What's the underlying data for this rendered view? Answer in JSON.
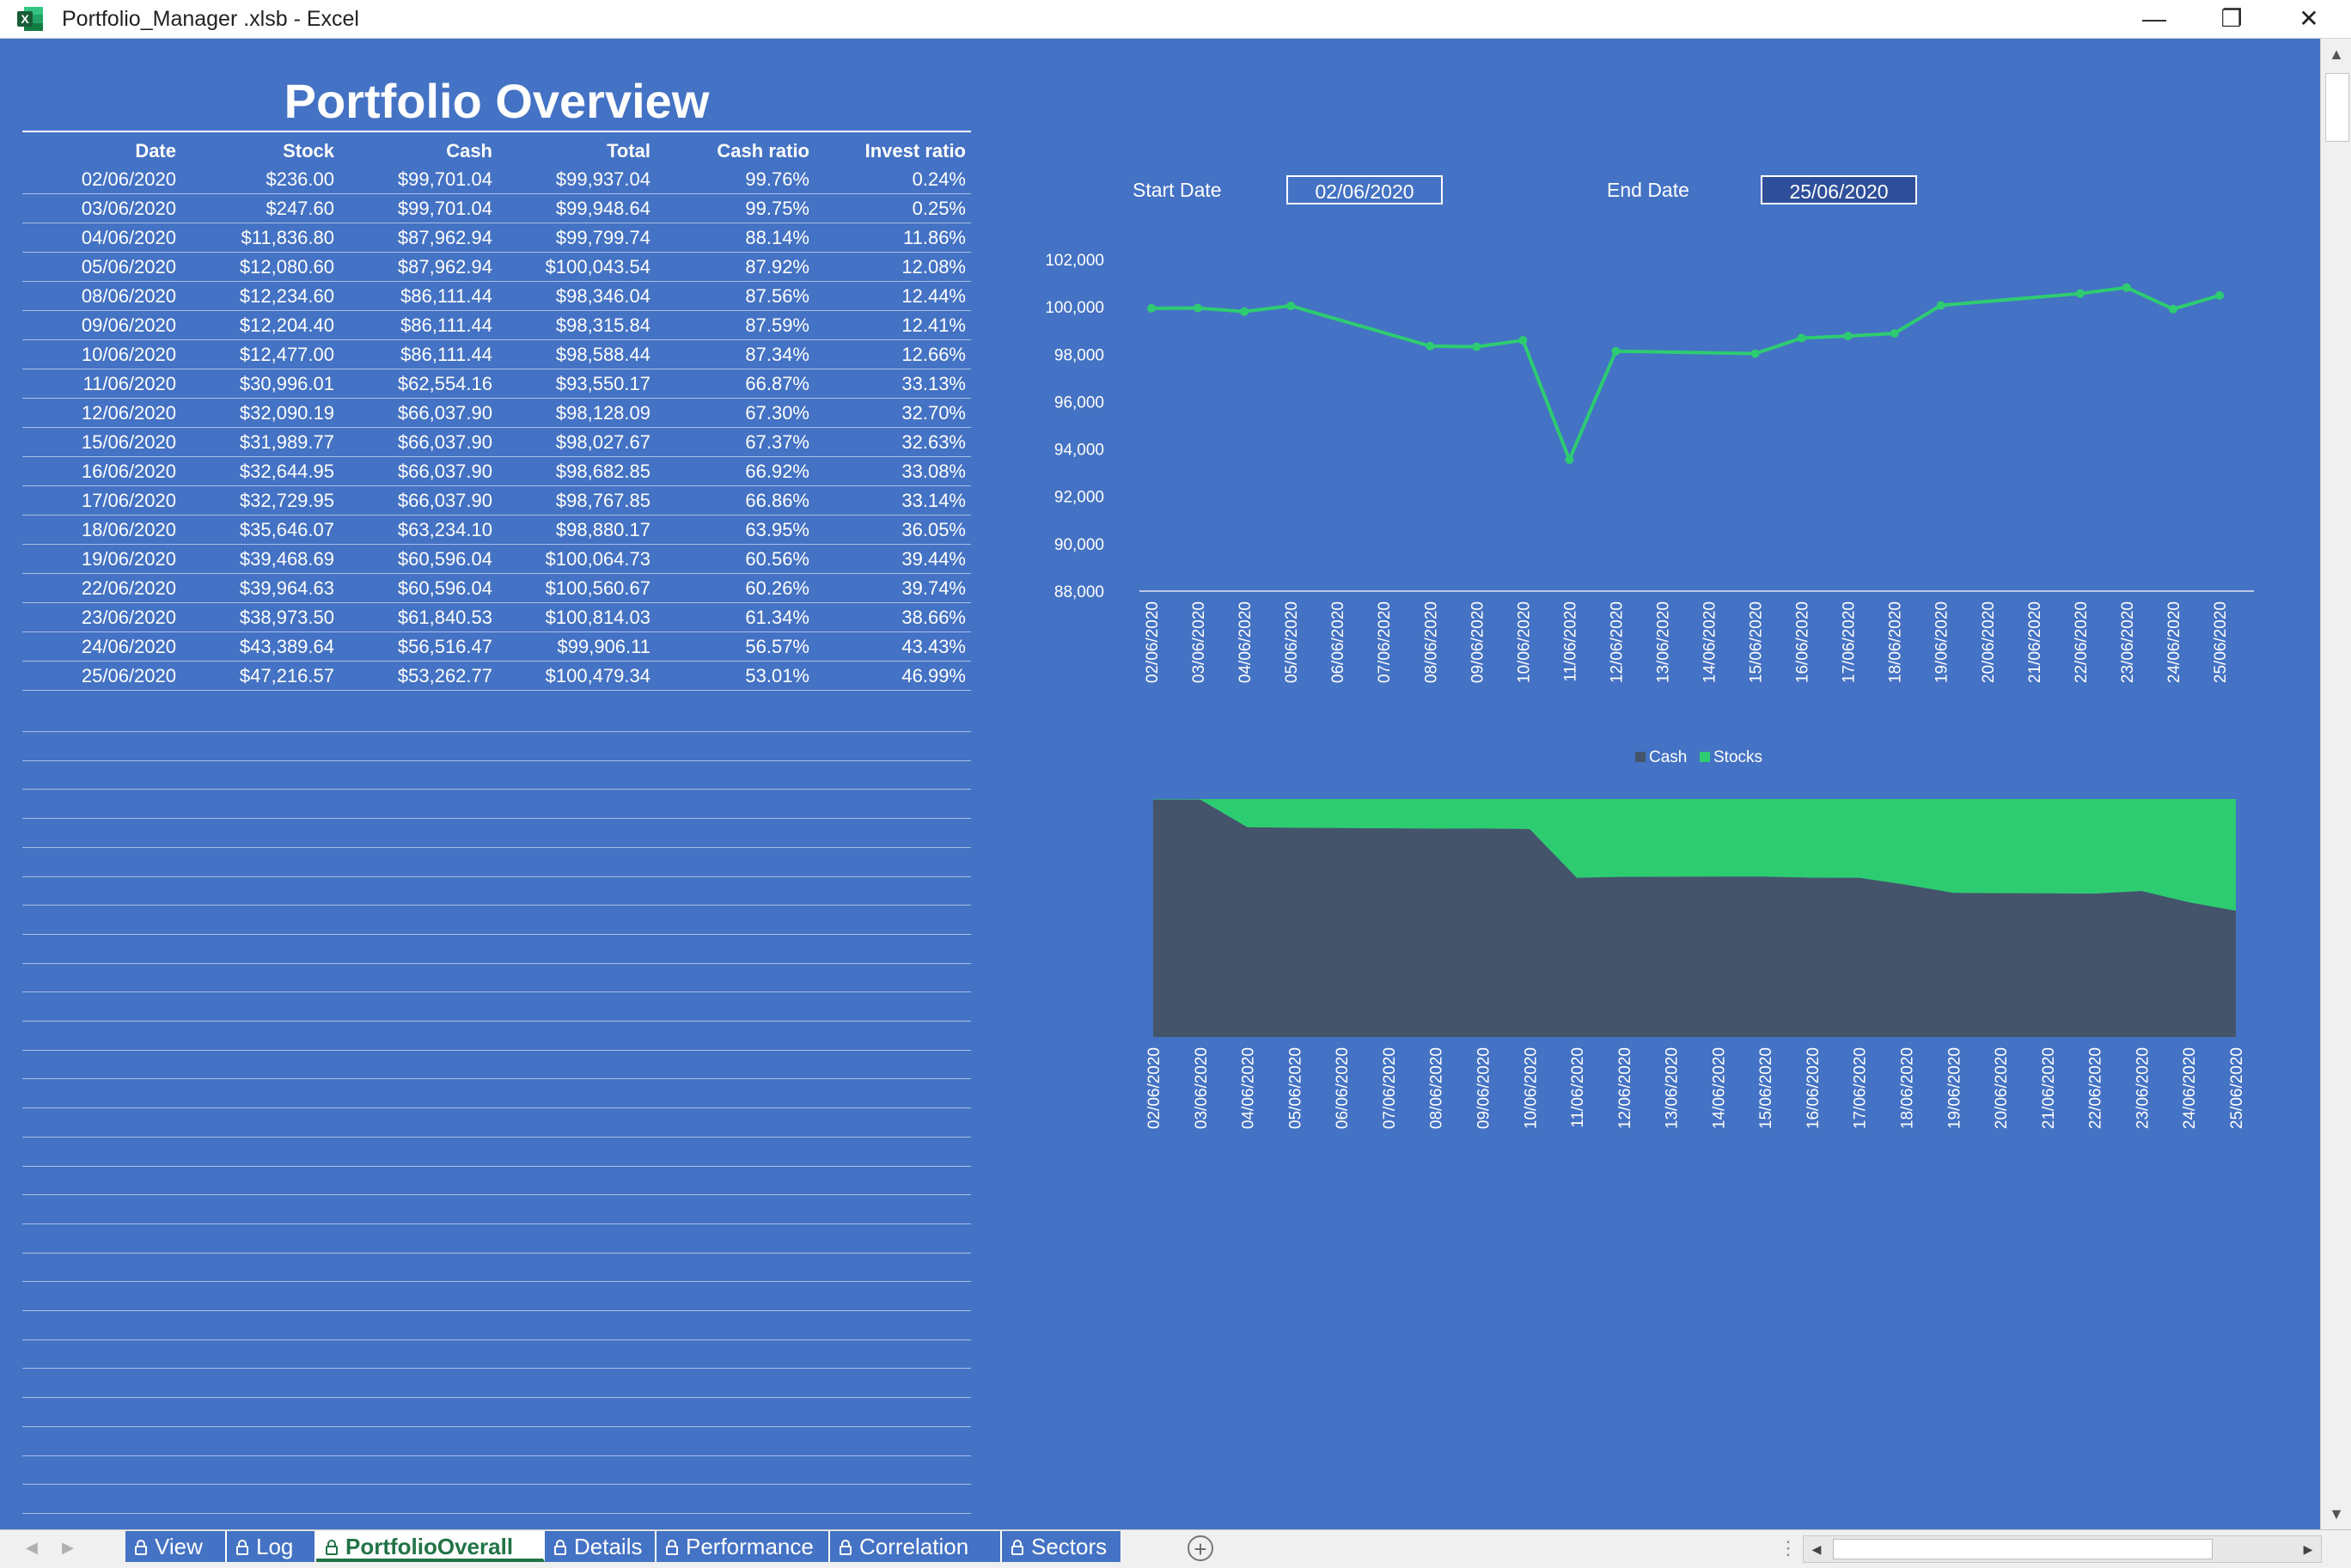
{
  "window": {
    "title": "Portfolio_Manager .xlsb - Excel",
    "minimize": "—",
    "restore": "❐",
    "close": "✕"
  },
  "sheet": {
    "title": "Portfolio Overview",
    "colors": {
      "background": "#4472c4",
      "line": "#2ecc71",
      "cash_area": "#44546a",
      "stocks_area": "#2ecc71"
    }
  },
  "table": {
    "headers": [
      "Date",
      "Stock",
      "Cash",
      "Total",
      "Cash ratio",
      "Invest ratio"
    ],
    "rows": [
      [
        "02/06/2020",
        "$236.00",
        "$99,701.04",
        "$99,937.04",
        "99.76%",
        "0.24%"
      ],
      [
        "03/06/2020",
        "$247.60",
        "$99,701.04",
        "$99,948.64",
        "99.75%",
        "0.25%"
      ],
      [
        "04/06/2020",
        "$11,836.80",
        "$87,962.94",
        "$99,799.74",
        "88.14%",
        "11.86%"
      ],
      [
        "05/06/2020",
        "$12,080.60",
        "$87,962.94",
        "$100,043.54",
        "87.92%",
        "12.08%"
      ],
      [
        "08/06/2020",
        "$12,234.60",
        "$86,111.44",
        "$98,346.04",
        "87.56%",
        "12.44%"
      ],
      [
        "09/06/2020",
        "$12,204.40",
        "$86,111.44",
        "$98,315.84",
        "87.59%",
        "12.41%"
      ],
      [
        "10/06/2020",
        "$12,477.00",
        "$86,111.44",
        "$98,588.44",
        "87.34%",
        "12.66%"
      ],
      [
        "11/06/2020",
        "$30,996.01",
        "$62,554.16",
        "$93,550.17",
        "66.87%",
        "33.13%"
      ],
      [
        "12/06/2020",
        "$32,090.19",
        "$66,037.90",
        "$98,128.09",
        "67.30%",
        "32.70%"
      ],
      [
        "15/06/2020",
        "$31,989.77",
        "$66,037.90",
        "$98,027.67",
        "67.37%",
        "32.63%"
      ],
      [
        "16/06/2020",
        "$32,644.95",
        "$66,037.90",
        "$98,682.85",
        "66.92%",
        "33.08%"
      ],
      [
        "17/06/2020",
        "$32,729.95",
        "$66,037.90",
        "$98,767.85",
        "66.86%",
        "33.14%"
      ],
      [
        "18/06/2020",
        "$35,646.07",
        "$63,234.10",
        "$98,880.17",
        "63.95%",
        "36.05%"
      ],
      [
        "19/06/2020",
        "$39,468.69",
        "$60,596.04",
        "$100,064.73",
        "60.56%",
        "39.44%"
      ],
      [
        "22/06/2020",
        "$39,964.63",
        "$60,596.04",
        "$100,560.67",
        "60.26%",
        "39.74%"
      ],
      [
        "23/06/2020",
        "$38,973.50",
        "$61,840.53",
        "$100,814.03",
        "61.34%",
        "38.66%"
      ],
      [
        "24/06/2020",
        "$43,389.64",
        "$56,516.47",
        "$99,906.11",
        "56.57%",
        "43.43%"
      ],
      [
        "25/06/2020",
        "$47,216.57",
        "$53,262.77",
        "$100,479.34",
        "53.01%",
        "46.99%"
      ]
    ]
  },
  "filters": {
    "start_label": "Start Date",
    "start_value": "02/06/2020",
    "end_label": "End Date",
    "end_value": "25/06/2020"
  },
  "chart_data": [
    {
      "type": "line",
      "x": [
        "02/06/2020",
        "03/06/2020",
        "04/06/2020",
        "05/06/2020",
        "06/06/2020",
        "07/06/2020",
        "08/06/2020",
        "09/06/2020",
        "10/06/2020",
        "11/06/2020",
        "12/06/2020",
        "13/06/2020",
        "14/06/2020",
        "15/06/2020",
        "16/06/2020",
        "17/06/2020",
        "18/06/2020",
        "19/06/2020",
        "20/06/2020",
        "21/06/2020",
        "22/06/2020",
        "23/06/2020",
        "24/06/2020",
        "25/06/2020"
      ],
      "points": [
        {
          "x": "02/06/2020",
          "y": 99937.04
        },
        {
          "x": "03/06/2020",
          "y": 99948.64
        },
        {
          "x": "04/06/2020",
          "y": 99799.74
        },
        {
          "x": "05/06/2020",
          "y": 100043.54
        },
        {
          "x": "08/06/2020",
          "y": 98346.04
        },
        {
          "x": "09/06/2020",
          "y": 98315.84
        },
        {
          "x": "10/06/2020",
          "y": 98588.44
        },
        {
          "x": "11/06/2020",
          "y": 93550.17
        },
        {
          "x": "12/06/2020",
          "y": 98128.09
        },
        {
          "x": "15/06/2020",
          "y": 98027.67
        },
        {
          "x": "16/06/2020",
          "y": 98682.85
        },
        {
          "x": "17/06/2020",
          "y": 98767.85
        },
        {
          "x": "18/06/2020",
          "y": 98880.17
        },
        {
          "x": "19/06/2020",
          "y": 100064.73
        },
        {
          "x": "22/06/2020",
          "y": 100560.67
        },
        {
          "x": "23/06/2020",
          "y": 100814.03
        },
        {
          "x": "24/06/2020",
          "y": 99906.11
        },
        {
          "x": "25/06/2020",
          "y": 100479.34
        }
      ],
      "yticks": [
        "102,000",
        "100,000",
        "98,000",
        "96,000",
        "94,000",
        "92,000",
        "90,000",
        "88,000"
      ],
      "ylim": [
        88000,
        102000
      ],
      "grid": false,
      "color": "#2ecc71"
    },
    {
      "type": "area",
      "stacked_percent": true,
      "legend": [
        "Cash",
        "Stocks"
      ],
      "legend_position": "top",
      "x": [
        "02/06/2020",
        "03/06/2020",
        "04/06/2020",
        "05/06/2020",
        "06/06/2020",
        "07/06/2020",
        "08/06/2020",
        "09/06/2020",
        "10/06/2020",
        "11/06/2020",
        "12/06/2020",
        "13/06/2020",
        "14/06/2020",
        "15/06/2020",
        "16/06/2020",
        "17/06/2020",
        "18/06/2020",
        "19/06/2020",
        "20/06/2020",
        "21/06/2020",
        "22/06/2020",
        "23/06/2020",
        "24/06/2020",
        "25/06/2020"
      ],
      "series": [
        {
          "name": "Cash",
          "color": "#44546a",
          "points": [
            {
              "x": "02/06/2020",
              "y": 99.76
            },
            {
              "x": "03/06/2020",
              "y": 99.75
            },
            {
              "x": "04/06/2020",
              "y": 88.14
            },
            {
              "x": "05/06/2020",
              "y": 87.92
            },
            {
              "x": "08/06/2020",
              "y": 87.56
            },
            {
              "x": "09/06/2020",
              "y": 87.59
            },
            {
              "x": "10/06/2020",
              "y": 87.34
            },
            {
              "x": "11/06/2020",
              "y": 66.87
            },
            {
              "x": "12/06/2020",
              "y": 67.3
            },
            {
              "x": "15/06/2020",
              "y": 67.37
            },
            {
              "x": "16/06/2020",
              "y": 66.92
            },
            {
              "x": "17/06/2020",
              "y": 66.86
            },
            {
              "x": "18/06/2020",
              "y": 63.95
            },
            {
              "x": "19/06/2020",
              "y": 60.56
            },
            {
              "x": "22/06/2020",
              "y": 60.26
            },
            {
              "x": "23/06/2020",
              "y": 61.34
            },
            {
              "x": "24/06/2020",
              "y": 56.57
            },
            {
              "x": "25/06/2020",
              "y": 53.01
            }
          ]
        },
        {
          "name": "Stocks",
          "color": "#2ecc71",
          "points": [
            {
              "x": "02/06/2020",
              "y": 0.24
            },
            {
              "x": "03/06/2020",
              "y": 0.25
            },
            {
              "x": "04/06/2020",
              "y": 11.86
            },
            {
              "x": "05/06/2020",
              "y": 12.08
            },
            {
              "x": "08/06/2020",
              "y": 12.44
            },
            {
              "x": "09/06/2020",
              "y": 12.41
            },
            {
              "x": "10/06/2020",
              "y": 12.66
            },
            {
              "x": "11/06/2020",
              "y": 33.13
            },
            {
              "x": "12/06/2020",
              "y": 32.7
            },
            {
              "x": "15/06/2020",
              "y": 32.63
            },
            {
              "x": "16/06/2020",
              "y": 33.08
            },
            {
              "x": "17/06/2020",
              "y": 33.14
            },
            {
              "x": "18/06/2020",
              "y": 36.05
            },
            {
              "x": "19/06/2020",
              "y": 39.44
            },
            {
              "x": "22/06/2020",
              "y": 39.74
            },
            {
              "x": "23/06/2020",
              "y": 38.66
            },
            {
              "x": "24/06/2020",
              "y": 43.43
            },
            {
              "x": "25/06/2020",
              "y": 46.99
            }
          ]
        }
      ]
    }
  ],
  "tabs": [
    {
      "label": "View",
      "icon": "lock-icon",
      "active": false
    },
    {
      "label": "Log",
      "icon": "lock-icon",
      "active": false
    },
    {
      "label": "PortfolioOverall",
      "icon": "lock-icon",
      "active": true
    },
    {
      "label": "Details",
      "icon": "lock-icon",
      "active": false
    },
    {
      "label": "Performance",
      "icon": "lock-icon",
      "active": false
    },
    {
      "label": "Correlation",
      "icon": "lock-icon",
      "active": false
    },
    {
      "label": "Sectors",
      "icon": "lock-icon",
      "active": false
    }
  ],
  "tabbar": {
    "add_sheet": "+",
    "nav_left": "◀",
    "nav_right": "▶",
    "split": "⋮"
  }
}
